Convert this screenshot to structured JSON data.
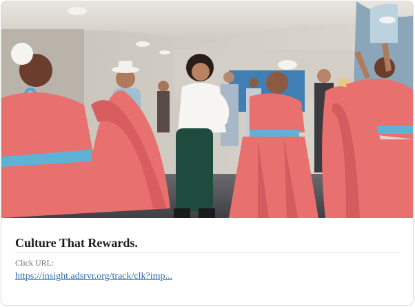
{
  "card": {
    "headline": "Culture That Rewards.",
    "click_url_label": "Click URL:",
    "click_url": "https://insight.adsrvr.org/track/clk?imp..."
  },
  "image": {
    "subject": "dancers-in-pink-dresses-photo"
  },
  "colors": {
    "dress": "#e8706f",
    "sash": "#5fb2d6",
    "link": "#2b6cb0",
    "headline": "#1b1b1b",
    "label": "#6d6d6d"
  }
}
